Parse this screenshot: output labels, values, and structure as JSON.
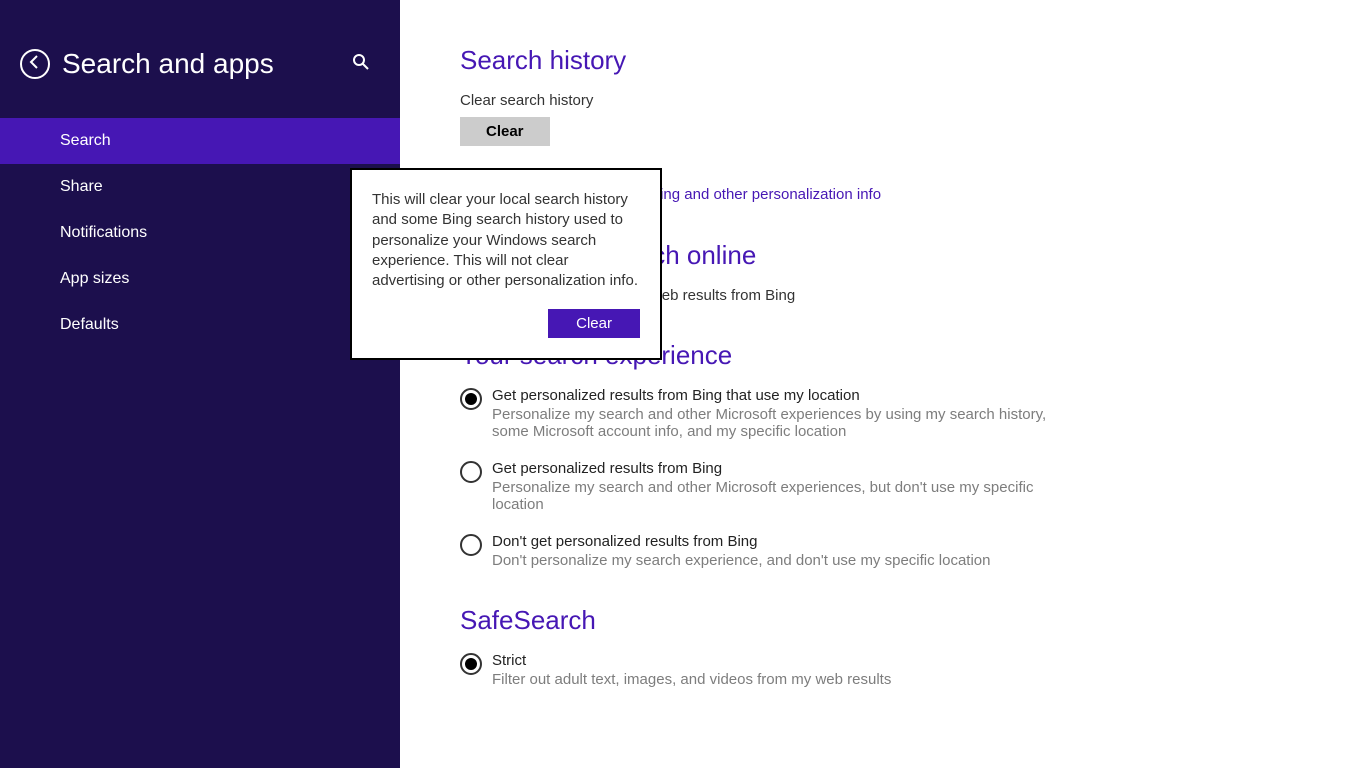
{
  "sidebar": {
    "title": "Search and apps",
    "items": [
      {
        "label": "Search"
      },
      {
        "label": "Share"
      },
      {
        "label": "Notifications"
      },
      {
        "label": "App sizes"
      },
      {
        "label": "Defaults"
      }
    ]
  },
  "content": {
    "search_history": {
      "title": "Search history",
      "clear_label": "Clear search history",
      "clear_button": "Clear",
      "link": "Manage my Microsoft advertising and other personalization info"
    },
    "use_bing": {
      "title": "Use Bing to search online",
      "body": "Get search suggestions and web results from Bing"
    },
    "experience": {
      "title": "Your search experience",
      "options": [
        {
          "title": "Get personalized results from Bing that use my location",
          "desc": "Personalize my search and other Microsoft experiences by using my search history, some Microsoft account info, and my specific location",
          "selected": true
        },
        {
          "title": "Get personalized results from Bing",
          "desc": "Personalize my search and other Microsoft experiences, but don't use my specific location",
          "selected": false
        },
        {
          "title": "Don't get personalized results from Bing",
          "desc": "Don't personalize my search experience, and don't use my specific location",
          "selected": false
        }
      ]
    },
    "safesearch": {
      "title": "SafeSearch",
      "options": [
        {
          "title": "Strict",
          "desc": "Filter out adult text, images, and videos from my web results",
          "selected": true
        }
      ]
    }
  },
  "popup": {
    "text": "This will clear your local search history and some Bing search history used to personalize your Windows search experience. This will not clear advertising or other personalization info.",
    "button": "Clear"
  }
}
